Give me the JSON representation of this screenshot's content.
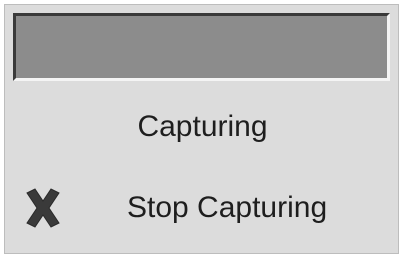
{
  "panel": {
    "display_value": "",
    "status_text": "Capturing",
    "stop_button": {
      "label": "Stop Capturing",
      "icon": "close-x-icon"
    }
  },
  "colors": {
    "panel_background": "#dcdcdc",
    "display_background": "#8c8c8c",
    "icon_color": "#3a3a3a",
    "text_color": "#1e1e1e"
  }
}
